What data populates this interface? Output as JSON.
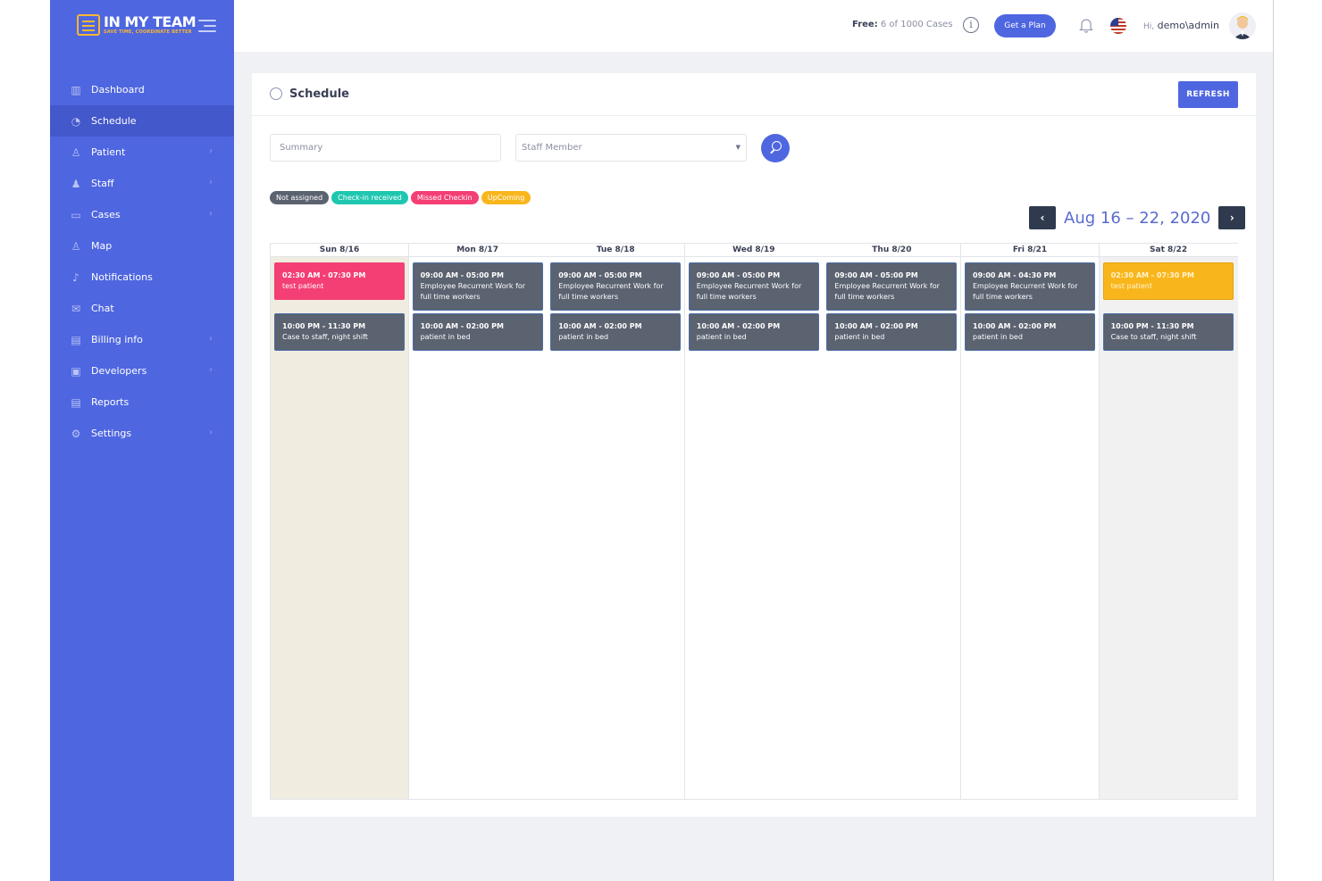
{
  "brand": {
    "name": "IN MY TEAM",
    "tagline": "SAVE TIME, COORDINATE BETTER",
    "accent": "#4e66e0",
    "logo_color": "#f7b731"
  },
  "sidebar": {
    "items": [
      {
        "label": "Dashboard",
        "icon": "bar-chart-icon",
        "glyph": "▥",
        "chevron": false,
        "active": false
      },
      {
        "label": "Schedule",
        "icon": "clock-icon",
        "glyph": "◔",
        "chevron": false,
        "active": true
      },
      {
        "label": "Patient",
        "icon": "patient-icon",
        "glyph": "♙",
        "chevron": true,
        "active": false
      },
      {
        "label": "Staff",
        "icon": "staff-icon",
        "glyph": "♟",
        "chevron": true,
        "active": false
      },
      {
        "label": "Cases",
        "icon": "cases-icon",
        "glyph": "▭",
        "chevron": true,
        "active": false
      },
      {
        "label": "Map",
        "icon": "map-user-icon",
        "glyph": "♙",
        "chevron": false,
        "active": false
      },
      {
        "label": "Notifications",
        "icon": "bell-icon",
        "glyph": "♪",
        "chevron": false,
        "active": false
      },
      {
        "label": "Chat",
        "icon": "chat-icon",
        "glyph": "✉",
        "chevron": false,
        "active": false
      },
      {
        "label": "Billing info",
        "icon": "billing-icon",
        "glyph": "▤",
        "chevron": true,
        "active": false
      },
      {
        "label": "Developers",
        "icon": "developers-icon",
        "glyph": "▣",
        "chevron": true,
        "active": false
      },
      {
        "label": "Reports",
        "icon": "reports-icon",
        "glyph": "▤",
        "chevron": false,
        "active": false
      },
      {
        "label": "Settings",
        "icon": "gear-icon",
        "glyph": "⚙",
        "chevron": true,
        "active": false
      }
    ]
  },
  "topbar": {
    "free_label": "Free:",
    "free_count": "6 of 1000 Cases",
    "plan_button": "Get a Plan",
    "greeting": "Hi,",
    "username": "demo\\admin"
  },
  "schedule": {
    "title": "Schedule",
    "refresh_label": "REFRESH",
    "summary_placeholder": "Summary",
    "staff_placeholder": "Staff Member",
    "week_label": "Aug 16 – 22, 2020",
    "legend": [
      {
        "label": "Not assigned",
        "color": "#5b6270"
      },
      {
        "label": "Check-in received",
        "color": "#1fc7b0"
      },
      {
        "label": "Missed Checkin",
        "color": "#f43f74"
      },
      {
        "label": "UpComing",
        "color": "#f9b61c"
      }
    ],
    "days": [
      {
        "label": "Sun 8/16",
        "bg": "#f0ede0",
        "events": [
          {
            "time": "02:30 AM - 07:30 PM",
            "title": "test patient",
            "status": "red"
          },
          {
            "time": "10:00 PM - 11:30 PM",
            "title": "Case to staff, night shift",
            "status": "gray"
          }
        ]
      },
      {
        "label": "Mon 8/17",
        "bg": "#ffffff",
        "events": [
          {
            "time": "09:00 AM - 05:00 PM",
            "title": "Employee Recurrent Work for full time workers",
            "status": "gray"
          },
          {
            "time": "10:00 AM - 02:00 PM",
            "title": "patient in bed",
            "status": "gray"
          }
        ]
      },
      {
        "label": "Tue 8/18",
        "bg": "#ffffff",
        "events": [
          {
            "time": "09:00 AM - 05:00 PM",
            "title": "Employee Recurrent Work for full time workers",
            "status": "gray"
          },
          {
            "time": "10:00 AM - 02:00 PM",
            "title": "patient in bed",
            "status": "gray"
          }
        ]
      },
      {
        "label": "Wed 8/19",
        "bg": "#ffffff",
        "events": [
          {
            "time": "09:00 AM - 05:00 PM",
            "title": "Employee Recurrent Work for full time workers",
            "status": "gray"
          },
          {
            "time": "10:00 AM - 02:00 PM",
            "title": "patient in bed",
            "status": "gray"
          }
        ]
      },
      {
        "label": "Thu 8/20",
        "bg": "#ffffff",
        "events": [
          {
            "time": "09:00 AM - 05:00 PM",
            "title": "Employee Recurrent Work for full time workers",
            "status": "gray"
          },
          {
            "time": "10:00 AM - 02:00 PM",
            "title": "patient in bed",
            "status": "gray"
          }
        ]
      },
      {
        "label": "Fri 8/21",
        "bg": "#ffffff",
        "events": [
          {
            "time": "09:00 AM - 04:30 PM",
            "title": "Employee Recurrent Work for full time workers",
            "status": "gray"
          },
          {
            "time": "10:00 AM - 02:00 PM",
            "title": "patient in bed",
            "status": "gray"
          }
        ]
      },
      {
        "label": "Sat 8/22",
        "bg": "#f1f1f1",
        "events": [
          {
            "time": "02:30 AM - 07:30 PM",
            "title": "test patient",
            "status": "yellow"
          },
          {
            "time": "10:00 PM - 11:30 PM",
            "title": "Case to staff, night shift",
            "status": "gray"
          }
        ]
      }
    ]
  }
}
